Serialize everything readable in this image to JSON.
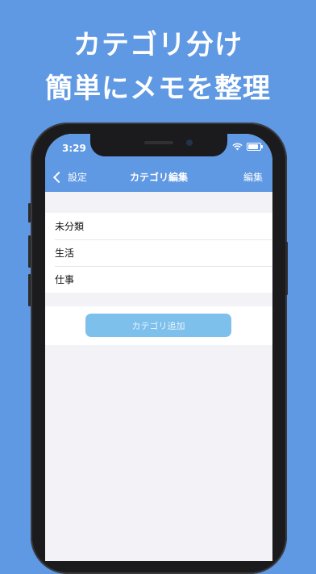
{
  "promo": {
    "line1": "カテゴリ分け",
    "line2": "簡単にメモを整理"
  },
  "status": {
    "time": "3:29"
  },
  "nav": {
    "back_label": "設定",
    "title": "カテゴリ編集",
    "edit_label": "編集"
  },
  "categories": [
    {
      "label": "未分類"
    },
    {
      "label": "生活"
    },
    {
      "label": "仕事"
    }
  ],
  "add_button": {
    "label": "カテゴリ追加"
  },
  "colors": {
    "accent": "#5f98e3",
    "button": "#7ec0ec",
    "background": "#f2f2f7"
  }
}
